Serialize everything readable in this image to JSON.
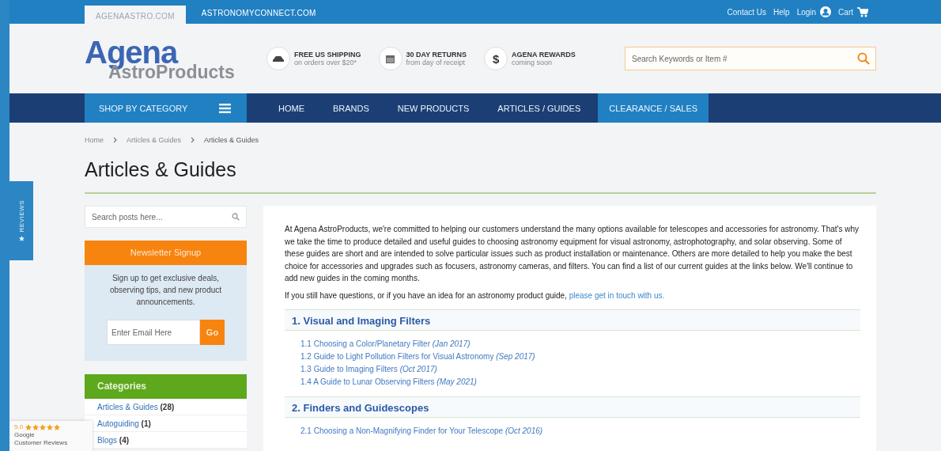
{
  "domain_tabs": [
    {
      "label": "AGENAASTRO.COM",
      "selected": true
    },
    {
      "label": "ASTRONOMYCONNECT.COM",
      "selected": false
    }
  ],
  "utility_links": [
    "Contact Us",
    "Help",
    "Login",
    "Cart"
  ],
  "logo": {
    "word": "Agena",
    "sub": "AstroProducts"
  },
  "features": [
    {
      "kind": "shipping",
      "title": "FREE US SHIPPING",
      "sub": "on orders over $20*"
    },
    {
      "kind": "returns",
      "title": "30 DAY RETURNS",
      "sub": "from day of receipt"
    },
    {
      "kind": "rewards",
      "title": "AGENA REWARDS",
      "sub": "coming soon",
      "icon_text": "$"
    }
  ],
  "search": {
    "placeholder": "Search Keywords or Item #"
  },
  "nav": {
    "shop_label": "SHOP BY CATEGORY",
    "items": [
      {
        "label": "HOME",
        "selected": false
      },
      {
        "label": "BRANDS",
        "selected": false
      },
      {
        "label": "NEW PRODUCTS",
        "selected": false
      },
      {
        "label": "ARTICLES / GUIDES",
        "selected": false
      },
      {
        "label": "CLEARANCE / SALES",
        "selected": true
      }
    ]
  },
  "breadcrumb": [
    "Home",
    "Articles & Guides",
    "Articles & Guides"
  ],
  "page_title": "Articles & Guides",
  "sidebar": {
    "search_placeholder": "Search posts here...",
    "newsletter": {
      "title": "Newsletter Signup",
      "text": "Sign up to get exclusive deals, observing tips, and new product announcements.",
      "email_placeholder": "Enter Email Here",
      "button": "Go"
    },
    "categories": {
      "title": "Categories",
      "items": [
        {
          "name": "Articles & Guides",
          "count": "(28)"
        },
        {
          "name": "Autoguiding",
          "count": "(1)"
        },
        {
          "name": "Blogs",
          "count": "(4)"
        }
      ]
    }
  },
  "intro": "At Agena AstroProducts, we're committed to helping our customers understand the many options available for telescopes and accessories for astronomy. That's why we take the time to produce detailed and useful guides to choosing astronomy equipment for visual astronomy, astrophotography, and solar observing. Some of these guides are short and are intended to solve particular issues such as product installation or maintenance. Others are more detailed to help you make the best choice for accessories and upgrades such as focusers, astronomy cameras, and filters. You can find a list of our current guides at the links below. We'll continue to add new guides in the coming months.",
  "contact": {
    "text": "If you still have questions, or if you have an idea for an astronomy product guide,",
    "link": "please get in touch with us."
  },
  "sections": [
    {
      "title": "1. Visual and Imaging Filters",
      "links": [
        {
          "title": "1.1 Choosing a Color/Planetary Filter",
          "date": "(Jan 2017)"
        },
        {
          "title": "1.2 Guide to Light Pollution Filters for Visual Astronomy",
          "date": "(Sep 2017)"
        },
        {
          "title": "1.3 Guide to Imaging Filters",
          "date": "(Oct 2017)"
        },
        {
          "title": "1.4 A Guide to Lunar Observing Filters",
          "date": "(May 2021)"
        }
      ]
    },
    {
      "title": "2. Finders and Guidescopes",
      "links": [
        {
          "title": "2.1 Choosing a Non-Magnifying Finder for Your Telescope",
          "date": "(Oct 2016)"
        }
      ]
    }
  ],
  "reviews_tab": "REVIEWS",
  "google_badge": {
    "rating": "5.0",
    "stars": 5,
    "line1": "Google",
    "line2": "Customer Reviews"
  }
}
